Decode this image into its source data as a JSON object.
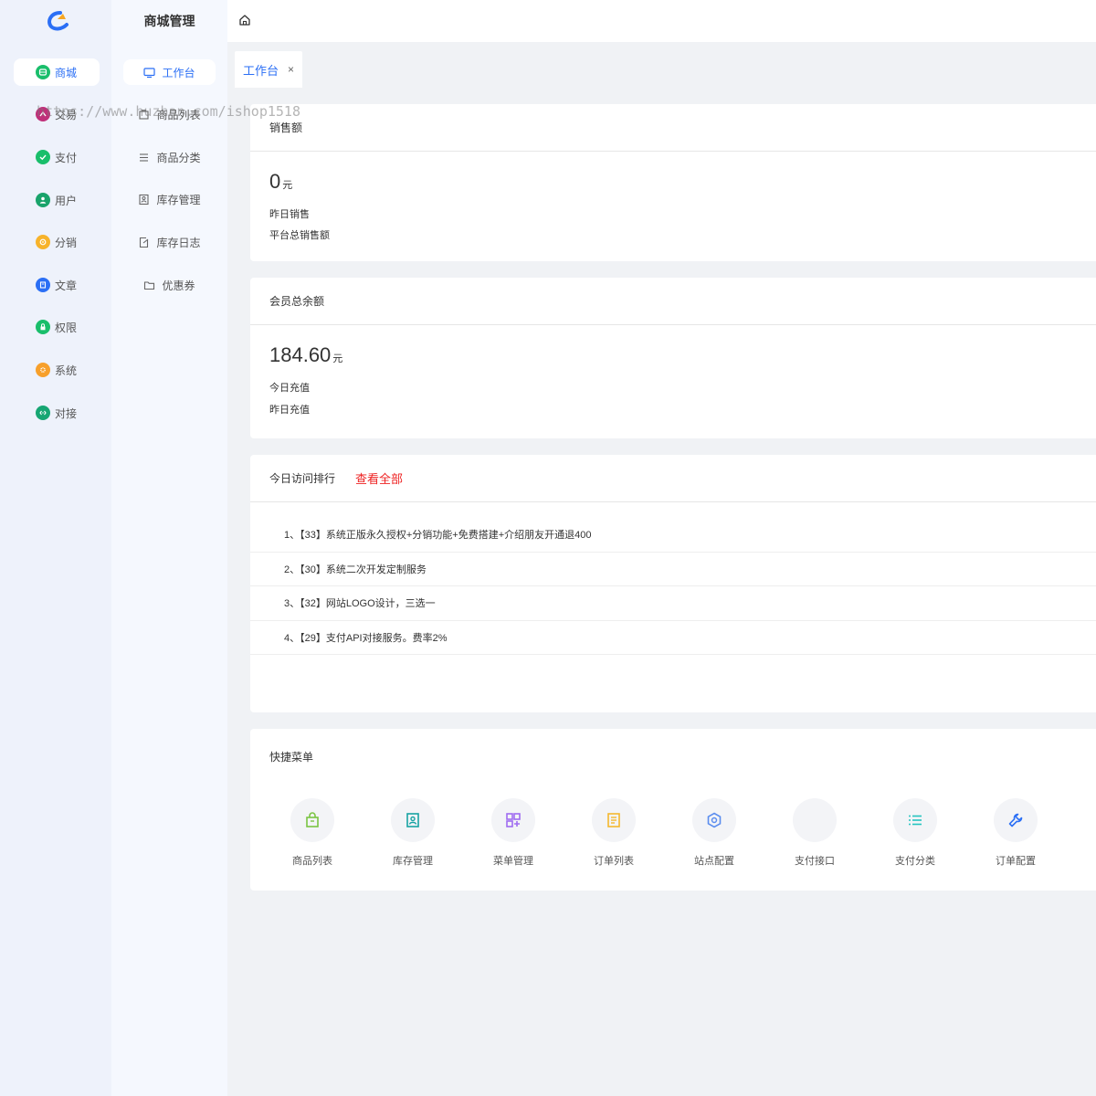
{
  "rail": {
    "items": [
      {
        "label": "商城",
        "color": "#19be6b",
        "icon": "store-icon"
      },
      {
        "label": "交易",
        "color": "#c0307a",
        "icon": "trade-icon"
      },
      {
        "label": "支付",
        "color": "#19be6b",
        "icon": "check-circle-icon"
      },
      {
        "label": "用户",
        "color": "#19a36b",
        "icon": "user-icon"
      },
      {
        "label": "分销",
        "color": "#f7b32b",
        "icon": "distribution-icon"
      },
      {
        "label": "文章",
        "color": "#2b6ff5",
        "icon": "article-icon"
      },
      {
        "label": "权限",
        "color": "#19be6b",
        "icon": "lock-icon"
      },
      {
        "label": "系统",
        "color": "#f7a02b",
        "icon": "gear-icon"
      },
      {
        "label": "对接",
        "color": "#17a673",
        "icon": "link-icon"
      }
    ]
  },
  "submenu": {
    "title": "商城管理",
    "items": [
      {
        "label": "工作台",
        "icon": "monitor-icon"
      },
      {
        "label": "商品列表",
        "icon": "goods-list-icon"
      },
      {
        "label": "商品分类",
        "icon": "category-icon"
      },
      {
        "label": "库存管理",
        "icon": "inventory-icon"
      },
      {
        "label": "库存日志",
        "icon": "log-icon"
      },
      {
        "label": "优惠券",
        "icon": "folder-icon"
      }
    ]
  },
  "tabs": [
    {
      "label": "工作台",
      "close": "×"
    }
  ],
  "watermark": "https://www.huzhan.com/ishop1518",
  "sales": {
    "title": "销售额",
    "value": "0",
    "unit": "元",
    "line1": "昨日销售",
    "line2": "平台总销售额"
  },
  "balance": {
    "title": "会员总余额",
    "value": "184.60",
    "unit": "元",
    "line1": "今日充值",
    "line2": "昨日充值"
  },
  "ranking": {
    "title": "今日访问排行",
    "view_all": "查看全部",
    "rows": [
      "1、【33】系统正版永久授权+分销功能+免费搭建+介绍朋友开通退400",
      "2、【30】系统二次开发定制服务",
      "3、【32】网站LOGO设计，三选一",
      "4、【29】支付API对接服务。费率2%"
    ]
  },
  "quick": {
    "title": "快捷菜单",
    "items": [
      {
        "label": "商品列表",
        "icon": "shopping-bag-icon",
        "color": "#7bc443"
      },
      {
        "label": "库存管理",
        "icon": "inventory-icon",
        "color": "#18a3a3"
      },
      {
        "label": "菜单管理",
        "icon": "grid-plus-icon",
        "color": "#a06cf0"
      },
      {
        "label": "订单列表",
        "icon": "order-icon",
        "color": "#f5b82e"
      },
      {
        "label": "站点配置",
        "icon": "hexagon-icon",
        "color": "#5b8def"
      },
      {
        "label": "支付接口",
        "icon": "payment-icon",
        "color": "#f3f4f7"
      },
      {
        "label": "支付分类",
        "icon": "list-icon",
        "color": "#24c3c0"
      },
      {
        "label": "订单配置",
        "icon": "wrench-icon",
        "color": "#2b6ff5"
      }
    ]
  }
}
